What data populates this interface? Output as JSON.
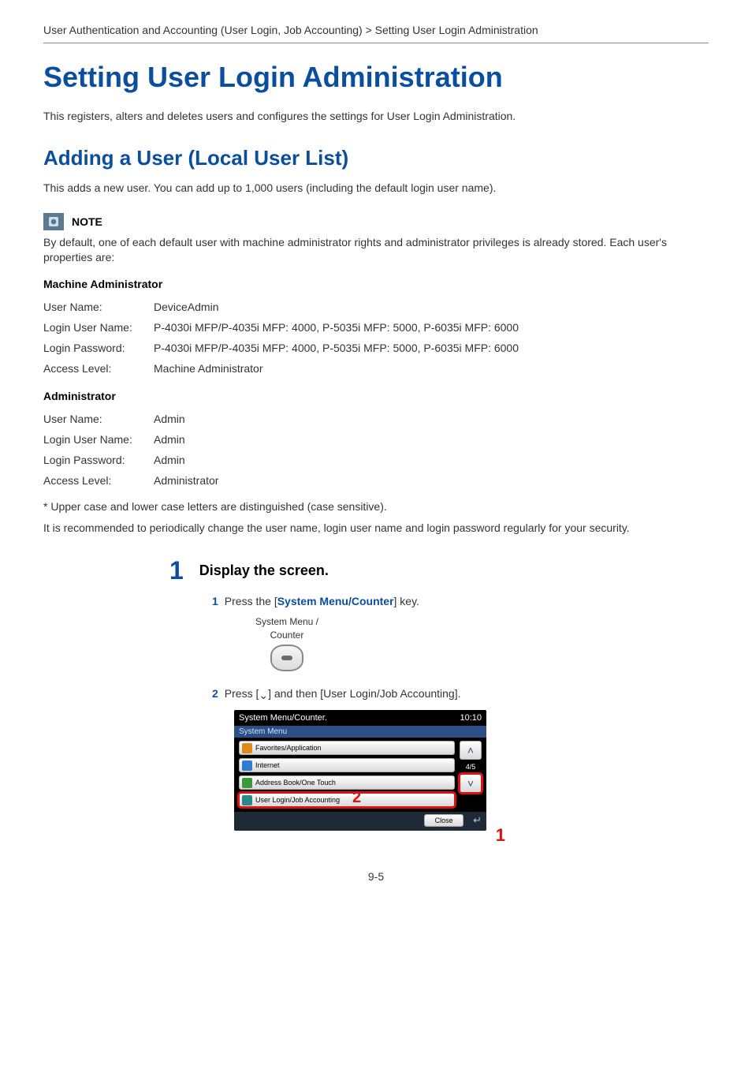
{
  "breadcrumb": "User Authentication and Accounting (User Login, Job Accounting) > Setting User Login Administration",
  "h1": "Setting User Login Administration",
  "intro": "This registers, alters and deletes users and configures the settings for User Login Administration.",
  "h2": "Adding a User (Local User List)",
  "sub_intro": "This adds a new user. You can add up to 1,000 users (including the default login user name).",
  "note": {
    "label": "NOTE",
    "body": "By default, one of each default user with machine administrator rights and administrator privileges is already stored. Each user's properties are:"
  },
  "machine_admin": {
    "heading": "Machine Administrator",
    "rows": [
      {
        "k": "User Name:",
        "v": "DeviceAdmin"
      },
      {
        "k": "Login User Name:",
        "v": "P-4030i MFP/P-4035i MFP: 4000, P-5035i MFP: 5000, P-6035i MFP: 6000"
      },
      {
        "k": "Login Password:",
        "v": "P-4030i MFP/P-4035i MFP: 4000, P-5035i MFP: 5000, P-6035i MFP: 6000"
      },
      {
        "k": "Access Level:",
        "v": "Machine Administrator"
      }
    ]
  },
  "administrator": {
    "heading": "Administrator",
    "rows": [
      {
        "k": "User Name:",
        "v": "Admin"
      },
      {
        "k": "Login User Name:",
        "v": "Admin"
      },
      {
        "k": "Login Password:",
        "v": "Admin"
      },
      {
        "k": "Access Level:",
        "v": "Administrator"
      }
    ]
  },
  "footnote": "* Upper case and lower case letters are distinguished (case sensitive).",
  "recommend": "It is recommended to periodically change the user name, login user name and login password regularly for your security.",
  "step": {
    "num": "1",
    "title": "Display the screen."
  },
  "substep1": {
    "num": "1",
    "prefix": "Press the [",
    "key": "System Menu/Counter",
    "suffix": "] key."
  },
  "key_graphic": {
    "line1": "System Menu /",
    "line2": "Counter"
  },
  "substep2": {
    "num": "2",
    "text_a": "Press [",
    "down": "⌄",
    "text_b": "] and then [User Login/Job Accounting]."
  },
  "panel": {
    "title": "System Menu/Counter.",
    "time": "10:10",
    "tab": "System Menu",
    "items": [
      "Favorites/Application",
      "Internet",
      "Address Book/One Touch",
      "User Login/Job Accounting"
    ],
    "page_ind": "4/5",
    "close": "Close",
    "callout1": "1",
    "callout2": "2"
  },
  "page_number": "9-5"
}
